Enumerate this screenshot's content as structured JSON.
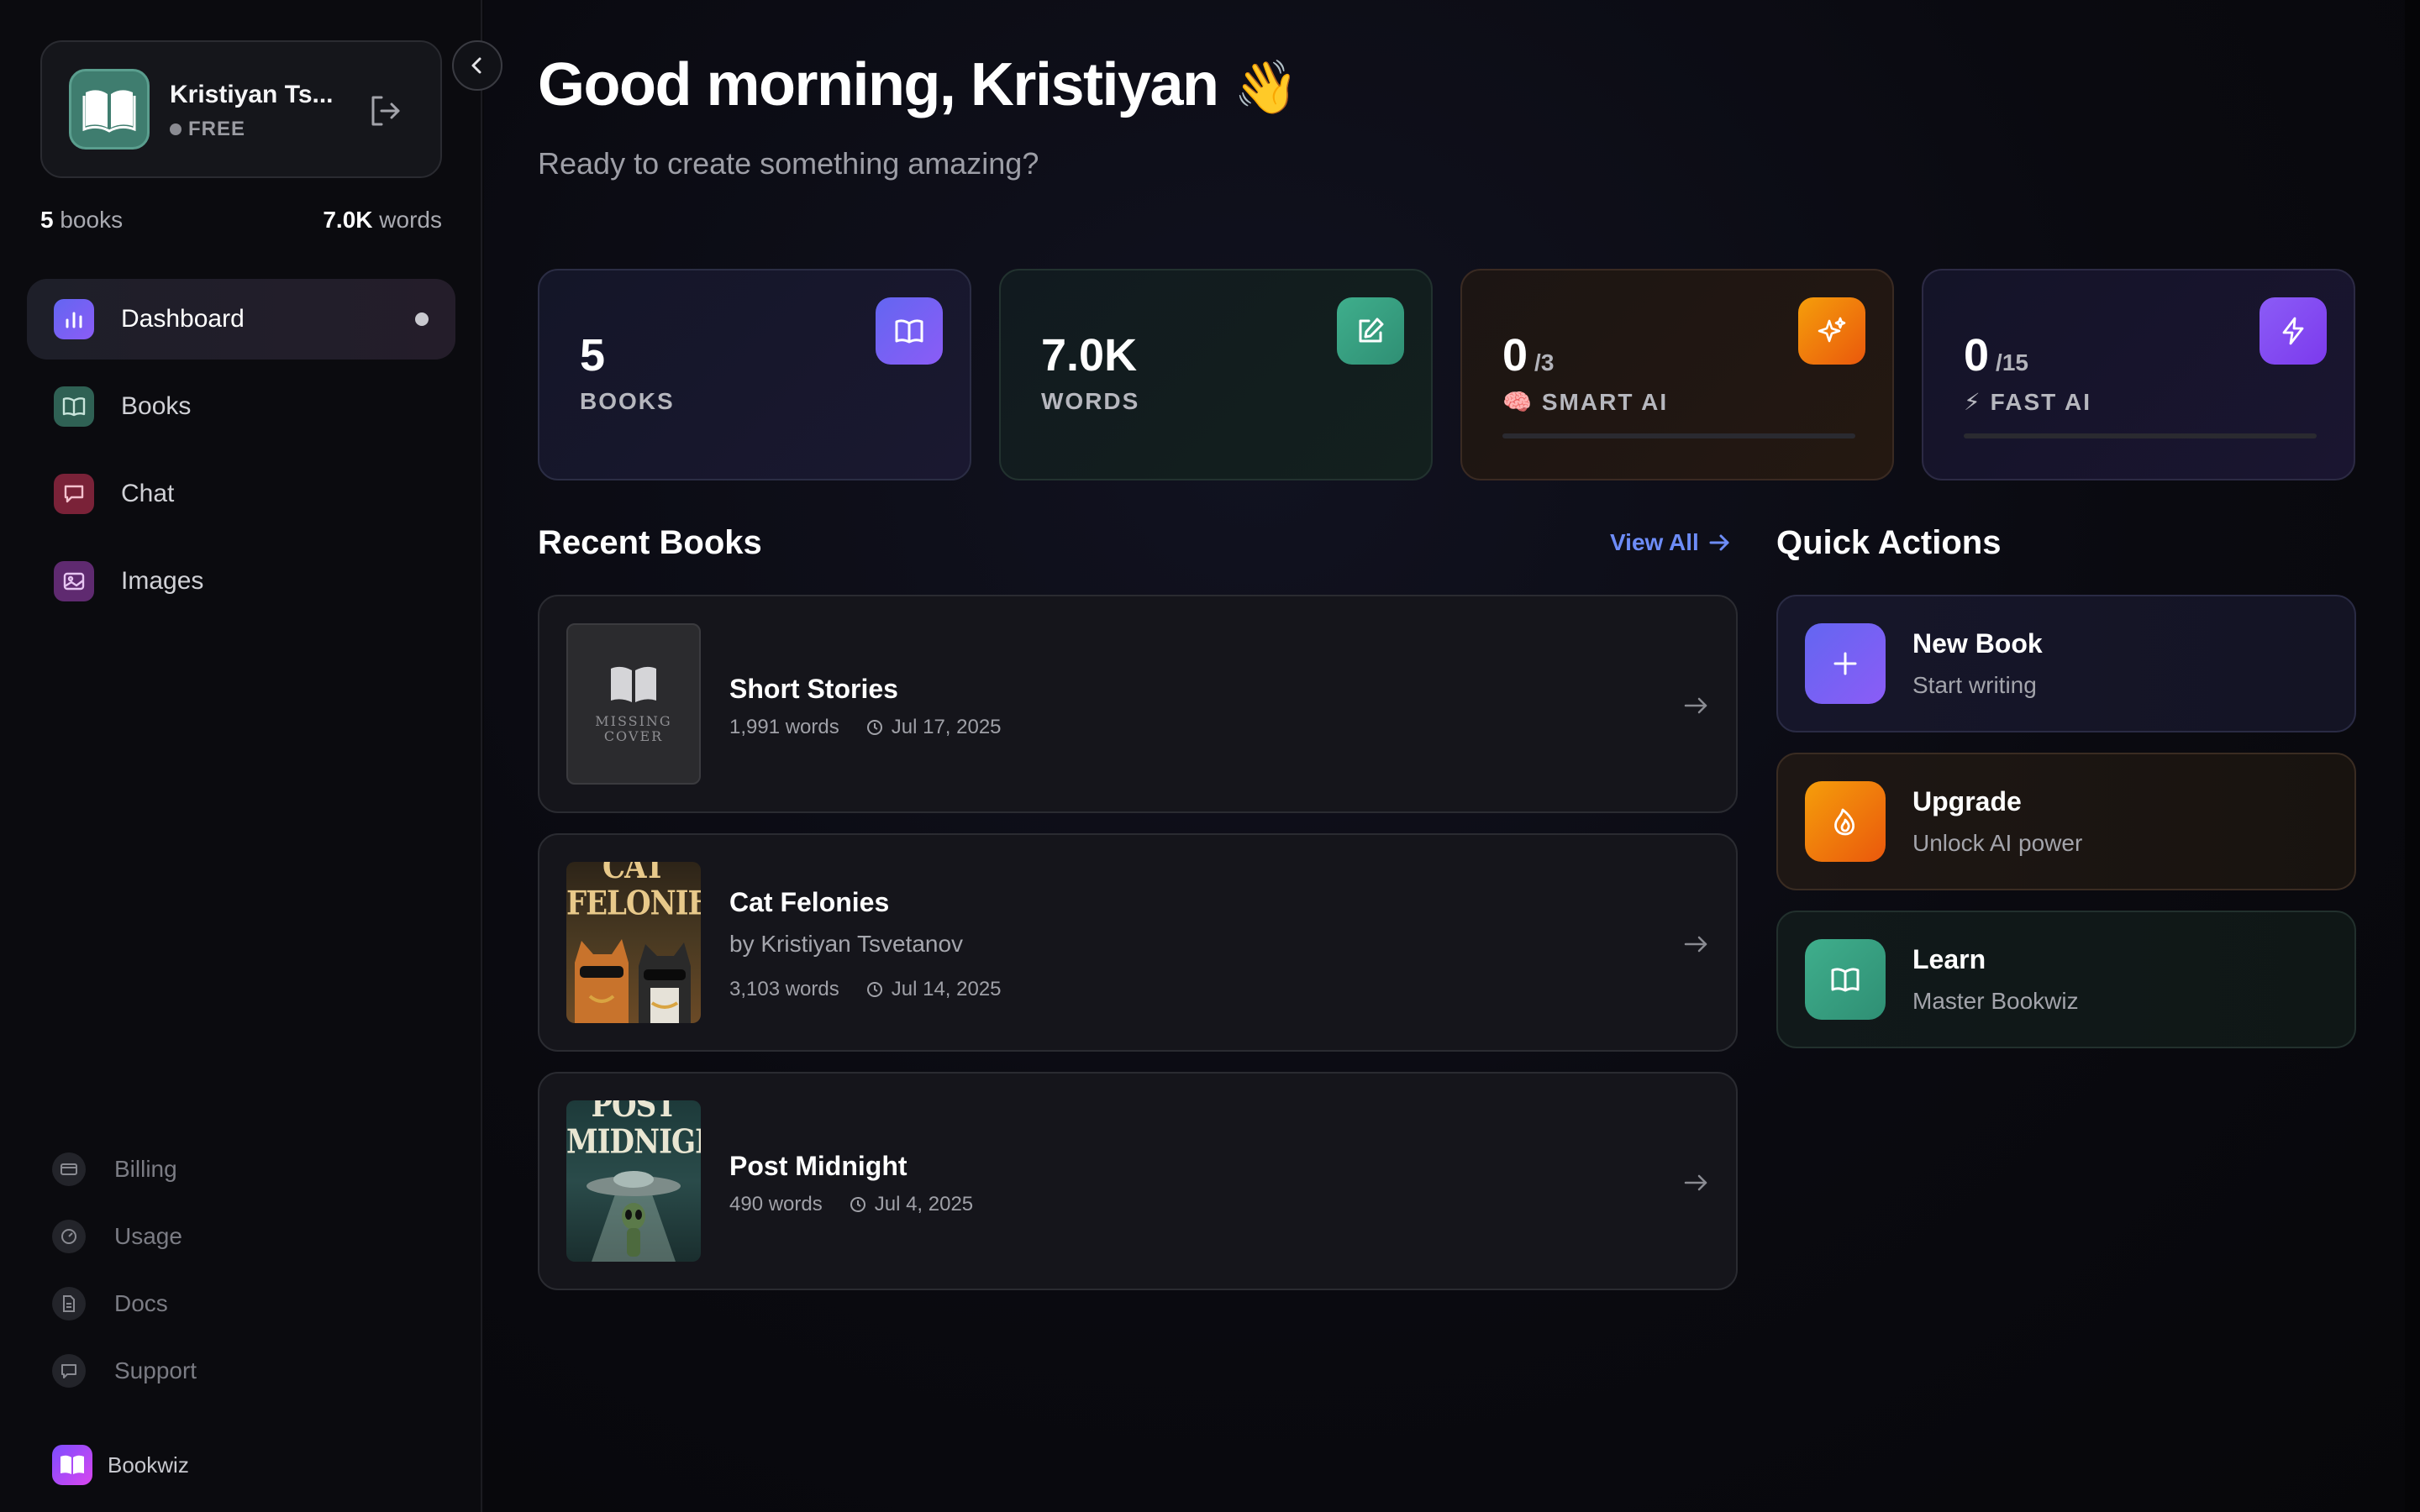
{
  "sidebar": {
    "profile": {
      "name": "Kristiyan Ts...",
      "plan": "FREE"
    },
    "stats": {
      "books_count": "5",
      "books_label": "books",
      "words_count": "7.0K",
      "words_label": "words"
    },
    "nav": [
      {
        "label": "Dashboard",
        "icon": "chart-icon",
        "color": "#6366f1"
      },
      {
        "label": "Books",
        "icon": "book-icon",
        "color": "#3f7d6f"
      },
      {
        "label": "Chat",
        "icon": "chat-icon",
        "color": "#9f2f4a"
      },
      {
        "label": "Images",
        "icon": "image-icon",
        "color": "#7e3a8f"
      }
    ],
    "bottom": [
      {
        "label": "Billing",
        "icon": "card-icon"
      },
      {
        "label": "Usage",
        "icon": "gauge-icon"
      },
      {
        "label": "Docs",
        "icon": "document-icon"
      },
      {
        "label": "Support",
        "icon": "support-icon"
      }
    ],
    "brand": "Bookwiz"
  },
  "header": {
    "greeting": "Good morning, Kristiyan",
    "wave": "👋",
    "subtitle": "Ready to create something amazing?"
  },
  "stats": {
    "books": {
      "value": "5",
      "label": "BOOKS"
    },
    "words": {
      "value": "7.0K",
      "label": "WORDS"
    },
    "smart_ai": {
      "value": "0",
      "limit": "/3",
      "emoji": "🧠",
      "label": "SMART AI",
      "used_fraction": 0
    },
    "fast_ai": {
      "value": "0",
      "limit": "/15",
      "emoji": "⚡",
      "label": "FAST AI",
      "used_fraction": 0
    }
  },
  "recent_books": {
    "title": "Recent Books",
    "view_all": "View All",
    "items": [
      {
        "title": "Short Stories",
        "author": "",
        "words": "1,991 words",
        "date": "Jul 17, 2025",
        "cover": "MISSING COVER"
      },
      {
        "title": "Cat Felonies",
        "author": "by Kristiyan Tsvetanov",
        "words": "3,103 words",
        "date": "Jul 14, 2025",
        "cover": "CAT FELONIES"
      },
      {
        "title": "Post Midnight",
        "author": "",
        "words": "490 words",
        "date": "Jul 4, 2025",
        "cover": "POST MIDNIGHT"
      }
    ]
  },
  "quick_actions": {
    "title": "Quick Actions",
    "items": [
      {
        "title": "New Book",
        "subtitle": "Start writing"
      },
      {
        "title": "Upgrade",
        "subtitle": "Unlock AI power"
      },
      {
        "title": "Learn",
        "subtitle": "Master Bookwiz"
      }
    ]
  },
  "colors": {
    "accent": "#6366f1",
    "accent_link": "#6d8cf7",
    "orange": "#f97316",
    "green": "#3fae8c",
    "purple": "#8b5cf6"
  }
}
